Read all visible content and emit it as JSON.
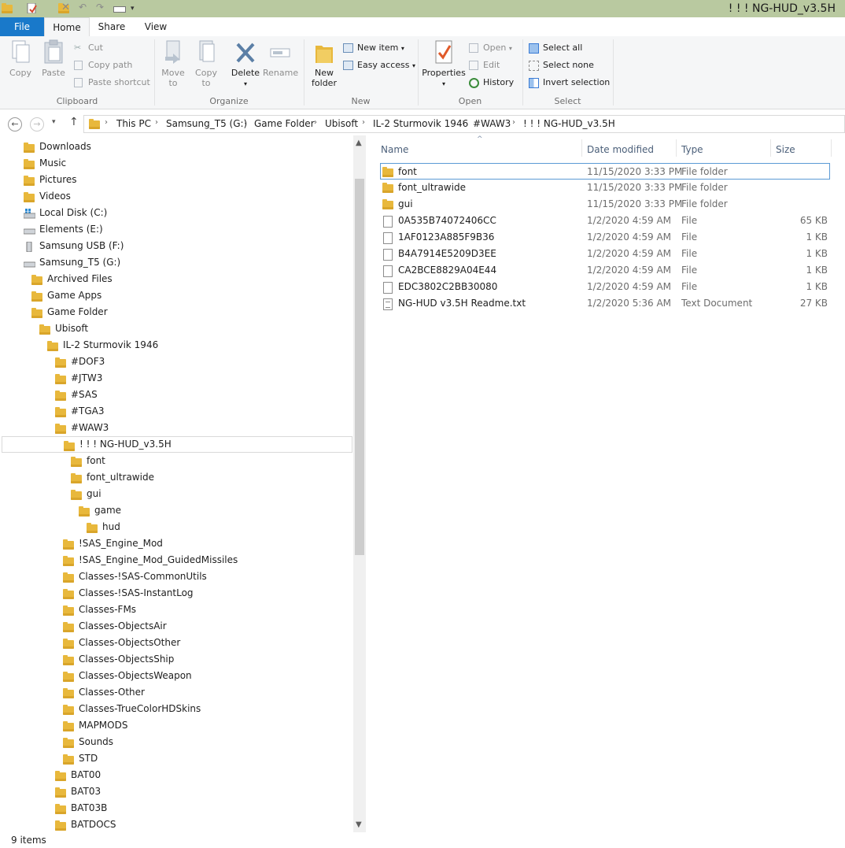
{
  "window": {
    "title": "! ! ! NG-HUD_v3.5H"
  },
  "tabs": {
    "file": "File",
    "home": "Home",
    "share": "Share",
    "view": "View"
  },
  "ribbon": {
    "clipboard": {
      "label": "Clipboard",
      "copy": "Copy",
      "paste": "Paste",
      "cut": "Cut",
      "copy_path": "Copy path",
      "paste_shortcut": "Paste shortcut"
    },
    "organize": {
      "label": "Organize",
      "move_to": "Move",
      "move_to2": "to",
      "copy_to": "Copy",
      "copy_to2": "to",
      "delete": "Delete",
      "rename": "Rename"
    },
    "new": {
      "label": "New",
      "new_folder": "New",
      "new_folder2": "folder",
      "new_item": "New item",
      "easy_access": "Easy access"
    },
    "open": {
      "label": "Open",
      "properties": "Properties",
      "open": "Open",
      "edit": "Edit",
      "history": "History"
    },
    "select": {
      "label": "Select",
      "select_all": "Select all",
      "select_none": "Select none",
      "invert": "Invert selection"
    }
  },
  "breadcrumb": [
    "This PC",
    "Samsung_T5 (G:)",
    "Game Folder",
    "Ubisoft",
    "IL-2 Sturmovik 1946",
    "#WAW3",
    "! ! ! NG-HUD_v3.5H"
  ],
  "tree": [
    {
      "label": "Downloads",
      "icon": "downloads-icon"
    },
    {
      "label": "Music",
      "icon": "music-icon"
    },
    {
      "label": "Pictures",
      "icon": "pictures-icon"
    },
    {
      "label": "Videos",
      "icon": "videos-icon"
    },
    {
      "label": "Local Disk (C:)",
      "icon": "windows-drive-icon"
    },
    {
      "label": "Elements (E:)",
      "icon": "drive-icon"
    },
    {
      "label": "Samsung USB (F:)",
      "icon": "usb-drive-icon"
    },
    {
      "label": "Samsung_T5 (G:)",
      "icon": "drive-icon"
    },
    {
      "label": "Archived Files",
      "icon": "folder-icon"
    },
    {
      "label": "Game Apps",
      "icon": "folder-icon"
    },
    {
      "label": "Game Folder",
      "icon": "folder-icon"
    },
    {
      "label": "Ubisoft",
      "icon": "folder-icon"
    },
    {
      "label": "IL-2 Sturmovik 1946",
      "icon": "folder-icon"
    },
    {
      "label": "#DOF3",
      "icon": "folder-icon"
    },
    {
      "label": "#JTW3",
      "icon": "folder-icon"
    },
    {
      "label": "#SAS",
      "icon": "folder-icon"
    },
    {
      "label": "#TGA3",
      "icon": "folder-icon"
    },
    {
      "label": "#WAW3",
      "icon": "folder-icon"
    },
    {
      "label": "! ! ! NG-HUD_v3.5H",
      "icon": "folder-icon",
      "selected": true
    },
    {
      "label": "font",
      "icon": "folder-icon"
    },
    {
      "label": "font_ultrawide",
      "icon": "folder-icon"
    },
    {
      "label": "gui",
      "icon": "folder-icon"
    },
    {
      "label": "game",
      "icon": "folder-icon"
    },
    {
      "label": "hud",
      "icon": "folder-icon"
    },
    {
      "label": "!SAS_Engine_Mod",
      "icon": "folder-icon"
    },
    {
      "label": "!SAS_Engine_Mod_GuidedMissiles",
      "icon": "folder-icon"
    },
    {
      "label": "Classes-!SAS-CommonUtils",
      "icon": "folder-icon"
    },
    {
      "label": "Classes-!SAS-InstantLog",
      "icon": "folder-icon"
    },
    {
      "label": "Classes-FMs",
      "icon": "folder-icon"
    },
    {
      "label": "Classes-ObjectsAir",
      "icon": "folder-icon"
    },
    {
      "label": "Classes-ObjectsOther",
      "icon": "folder-icon"
    },
    {
      "label": "Classes-ObjectsShip",
      "icon": "folder-icon"
    },
    {
      "label": "Classes-ObjectsWeapon",
      "icon": "folder-icon"
    },
    {
      "label": "Classes-Other",
      "icon": "folder-icon"
    },
    {
      "label": "Classes-TrueColorHDSkins",
      "icon": "folder-icon"
    },
    {
      "label": "MAPMODS",
      "icon": "folder-icon"
    },
    {
      "label": "Sounds",
      "icon": "folder-icon"
    },
    {
      "label": "STD",
      "icon": "folder-icon"
    },
    {
      "label": "BAT00",
      "icon": "folder-icon"
    },
    {
      "label": "BAT03",
      "icon": "folder-icon"
    },
    {
      "label": "BAT03B",
      "icon": "folder-icon"
    },
    {
      "label": "BATDOCS",
      "icon": "folder-icon"
    }
  ],
  "columns": {
    "name": "Name",
    "date": "Date modified",
    "type": "Type",
    "size": "Size"
  },
  "files": [
    {
      "name": "font",
      "date": "11/15/2020 3:33 PM",
      "type": "File folder",
      "size": "",
      "icon": "folder-icon",
      "selected": true
    },
    {
      "name": "font_ultrawide",
      "date": "11/15/2020 3:33 PM",
      "type": "File folder",
      "size": "",
      "icon": "folder-icon"
    },
    {
      "name": "gui",
      "date": "11/15/2020 3:33 PM",
      "type": "File folder",
      "size": "",
      "icon": "folder-icon"
    },
    {
      "name": "0A535B74072406CC",
      "date": "1/2/2020 4:59 AM",
      "type": "File",
      "size": "65 KB",
      "icon": "file-icon"
    },
    {
      "name": "1AF0123A885F9B36",
      "date": "1/2/2020 4:59 AM",
      "type": "File",
      "size": "1 KB",
      "icon": "file-icon"
    },
    {
      "name": "B4A7914E5209D3EE",
      "date": "1/2/2020 4:59 AM",
      "type": "File",
      "size": "1 KB",
      "icon": "file-icon"
    },
    {
      "name": "CA2BCE8829A04E44",
      "date": "1/2/2020 4:59 AM",
      "type": "File",
      "size": "1 KB",
      "icon": "file-icon"
    },
    {
      "name": "EDC3802C2BB30080",
      "date": "1/2/2020 4:59 AM",
      "type": "File",
      "size": "1 KB",
      "icon": "file-icon"
    },
    {
      "name": "NG-HUD v3.5H Readme.txt",
      "date": "1/2/2020 5:36 AM",
      "type": "Text Document",
      "size": "27 KB",
      "icon": "text-file-icon"
    }
  ],
  "status": {
    "count": "9 items"
  },
  "colors": {
    "accent": "#1979ca",
    "titlebar": "#b9c9a0",
    "folder": "#e8b83c",
    "selection": "#5b9bd5"
  }
}
